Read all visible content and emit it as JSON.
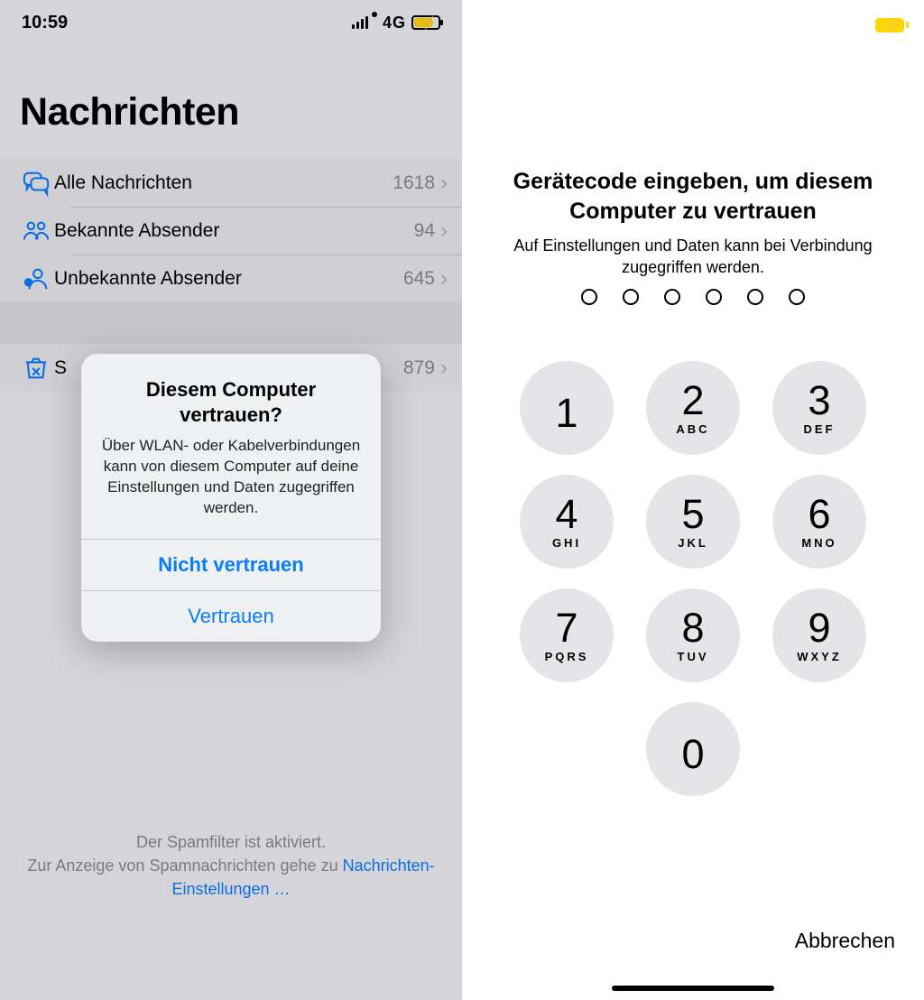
{
  "left": {
    "status": {
      "time": "10:59",
      "network": "4G"
    },
    "title": "Nachrichten",
    "rows": [
      {
        "icon": "chat",
        "label": "Alle Nachrichten",
        "count": "1618"
      },
      {
        "icon": "people",
        "label": "Bekannte Absender",
        "count": "94"
      },
      {
        "icon": "unknown",
        "label": "Unbekannte Absender",
        "count": "645"
      }
    ],
    "spam_row": {
      "label_visible": "S",
      "count_visible": "879"
    },
    "footer": {
      "line1": "Der Spamfilter ist aktiviert.",
      "line2_pre": "Zur Anzeige von Spamnachrichten gehe zu ",
      "link": "Nachrichten-Einstellungen …"
    },
    "alert": {
      "title": "Diesem Computer vertrauen?",
      "message": "Über WLAN- oder Kabelverbindungen kann von diesem Computer auf deine Einstellungen und Daten zugegriffen werden.",
      "primary": "Nicht vertrauen",
      "secondary": "Vertrauen"
    }
  },
  "right": {
    "prompt_title": "Gerätecode eingeben, um diesem Computer zu vertrauen",
    "prompt_sub": "Auf Einstellungen und Daten kann bei Verbindung zugegriffen werden.",
    "passcode_length": 6,
    "keys": [
      {
        "d": "1",
        "l": ""
      },
      {
        "d": "2",
        "l": "ABC"
      },
      {
        "d": "3",
        "l": "DEF"
      },
      {
        "d": "4",
        "l": "GHI"
      },
      {
        "d": "5",
        "l": "JKL"
      },
      {
        "d": "6",
        "l": "MNO"
      },
      {
        "d": "7",
        "l": "PQRS"
      },
      {
        "d": "8",
        "l": "TUV"
      },
      {
        "d": "9",
        "l": "WXYZ"
      },
      {
        "d": "0",
        "l": ""
      }
    ],
    "cancel": "Abbrechen"
  }
}
